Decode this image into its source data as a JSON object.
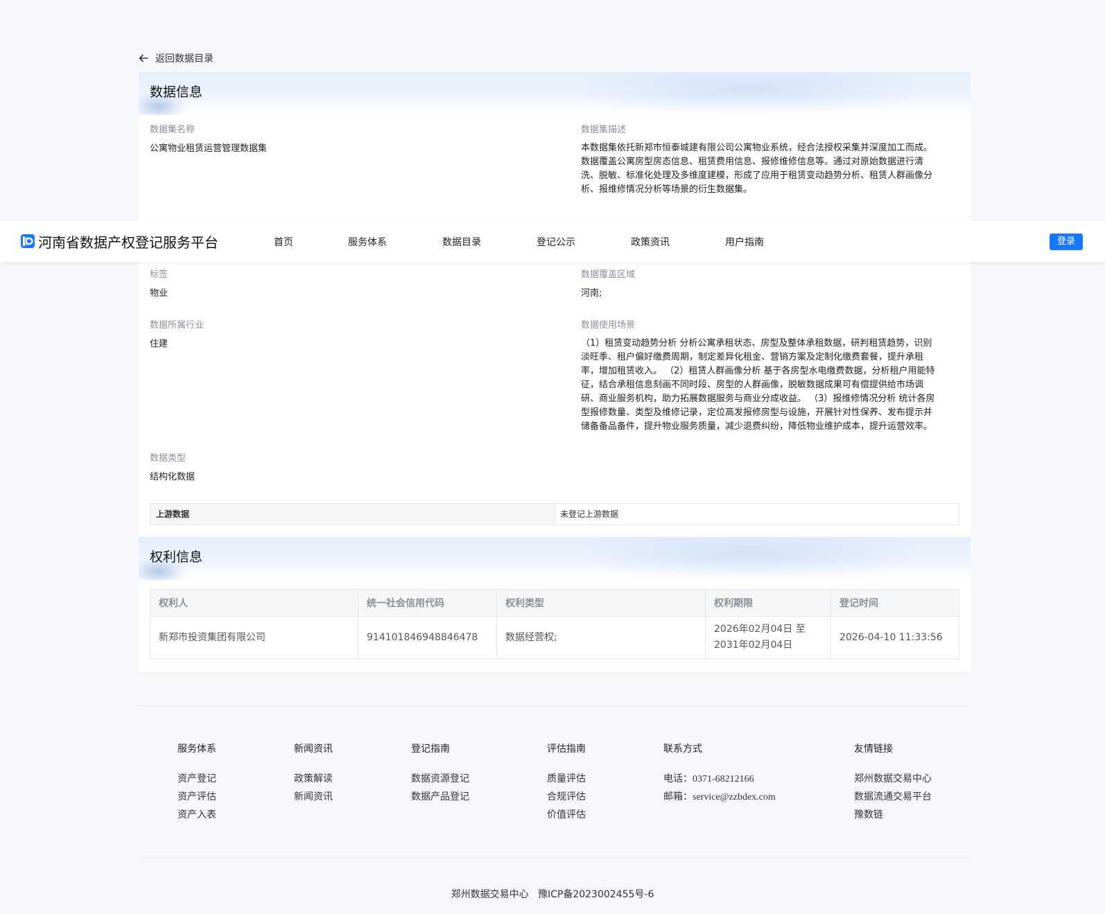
{
  "back_link": "返回数据目录",
  "data_info": {
    "title": "数据信息",
    "name_label": "数据集名称",
    "name_value": "公寓物业租赁运营管理数据集",
    "desc_label": "数据集描述",
    "desc_lines": [
      "本数据集依托新郑市恒泰城建有限公司公寓物业系统，经合法授权采集并深度加工而成。",
      "数据覆盖公寓房型房态信息、租赁费用信息、报修维修信息等。通过对原始数据进行清",
      "洗、脱敏、标准化处理及多维度建模，形成了应用于租赁变动趋势分析、租赁人群画像分",
      "析、报维修情况分析等场景的衍生数据集。"
    ],
    "tag_label": "标签",
    "tag_value": "物业",
    "region_label": "数据覆盖区域",
    "region_value": "河南;",
    "industry_label": "数据所属行业",
    "industry_value": "住建",
    "scene_label": "数据使用场景",
    "scene_lines": [
      "（1）租赁变动趋势分析 分析公寓承租状态、房型及整体承租数据，研判租赁趋势，识别",
      "淡旺季、租户偏好缴费周期，制定差异化租金、营销方案及定制化缴费套餐，提升承租",
      "率，增加租赁收入。 （2）租赁人群画像分析 基于各房型水电缴费数据，分析租户用能特",
      "征，结合承租信息刻画不同时段、房型的人群画像，脱敏数据成果可有偿提供给市场调",
      "研、商业服务机构，助力拓展数据服务与商业分成收益。 （3）报维修情况分析 统计各房",
      "型报修数量、类型及维修记录，定位高发报修房型与设施，开展针对性保养、发布提示并",
      "储备备品备件，提升物业服务质量，减少退费纠纷，降低物业维护成本，提升运营效率。"
    ],
    "type_label": "数据类型",
    "type_value": "结构化数据",
    "upstream_label": "上游数据",
    "upstream_value": "未登记上游数据"
  },
  "rights_info": {
    "title": "权利信息",
    "headers": [
      "权利人",
      "统一社会信用代码",
      "权利类型",
      "权利期限",
      "登记时间"
    ],
    "row": {
      "holder": "新郑市投资集团有限公司",
      "credit_code": "914101846948846478",
      "right_type": "数据经营权;",
      "period_line1": "2026年02月04日 至",
      "period_line2": "2031年02月04日",
      "reg_time": "2026-04-10 11:33:56"
    }
  },
  "navbar": {
    "brand": "河南省数据产权登记服务平台",
    "items": [
      "首页",
      "服务体系",
      "数据目录",
      "登记公示",
      "政策资讯",
      "用户指南"
    ],
    "login": "登录"
  },
  "footer": {
    "cols": [
      {
        "title": "服务体系",
        "items": [
          "资产登记",
          "资产评估",
          "资产入表"
        ]
      },
      {
        "title": "新闻资讯",
        "items": [
          "政策解读",
          "新闻资讯"
        ]
      },
      {
        "title": "登记指南",
        "items": [
          "数据资源登记",
          "数据产品登记"
        ]
      },
      {
        "title": "评估指南",
        "items": [
          "质量评估",
          "合规评估",
          "价值评估"
        ]
      }
    ],
    "contact": {
      "title": "联系方式",
      "phone_label": "电话：",
      "phone": "0371-68212166",
      "email_label": "邮箱：",
      "email": "service@zzbdex.com"
    },
    "links": {
      "title": "友情链接",
      "items": [
        "郑州数据交易中心",
        "数据流通交易平台",
        "豫数链"
      ]
    },
    "copyright": "郑州数据交易中心   豫ICP备2023002455号-6"
  },
  "colors": {
    "accent": "#1677ff",
    "page_bg": "#f5f7fb"
  }
}
